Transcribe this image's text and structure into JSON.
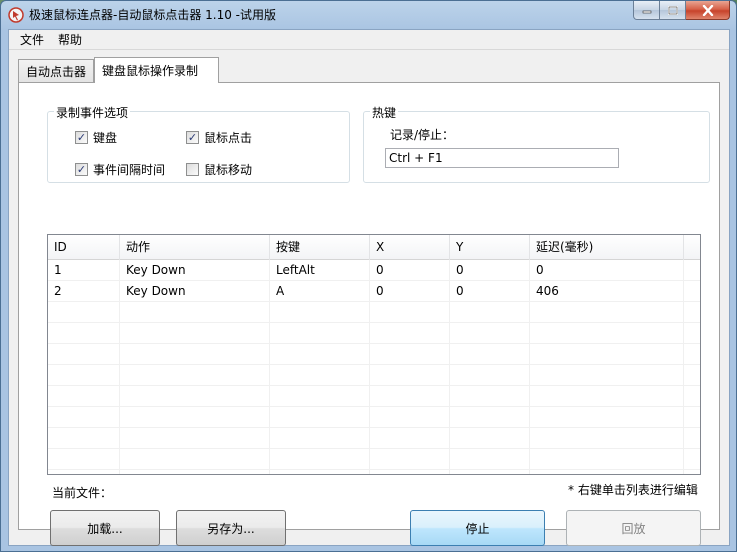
{
  "window": {
    "title": "极速鼠标连点器-自动鼠标点击器 1.10  -试用版"
  },
  "menu": {
    "items": [
      {
        "label": "文件"
      },
      {
        "label": "帮助"
      }
    ]
  },
  "tabs": [
    {
      "label": "自动点击器",
      "active": false
    },
    {
      "label": "键盘鼠标操作录制",
      "active": true
    }
  ],
  "record_options": {
    "title": "录制事件选项",
    "keyboard": {
      "label": "键盘",
      "checked": true
    },
    "mouse_click": {
      "label": "鼠标点击",
      "checked": true
    },
    "event_interval": {
      "label": "事件间隔时间",
      "checked": true
    },
    "mouse_move": {
      "label": "鼠标移动",
      "checked": false
    }
  },
  "hotkey": {
    "title": "热键",
    "label": "记录/停止：",
    "value": "Ctrl + F1"
  },
  "events_table": {
    "columns": [
      "ID",
      "动作",
      "按键",
      "X",
      "Y",
      "延迟(毫秒)"
    ],
    "rows": [
      [
        "1",
        "Key Down",
        "LeftAlt",
        "0",
        "0",
        "0"
      ],
      [
        "2",
        "Key Down",
        "A",
        "0",
        "0",
        "406"
      ]
    ]
  },
  "status": {
    "current_file_label": "当前文件：",
    "hint": "* 右键单击列表进行编辑"
  },
  "buttons": {
    "load": "加载...",
    "save_as": "另存为...",
    "stop": "停止",
    "playback": "回放"
  },
  "icons": {
    "app": "mouse-clicker-icon",
    "minimize": "minimize-icon",
    "maximize": "maximize-icon",
    "close": "close-icon",
    "check": "checkmark-icon"
  }
}
